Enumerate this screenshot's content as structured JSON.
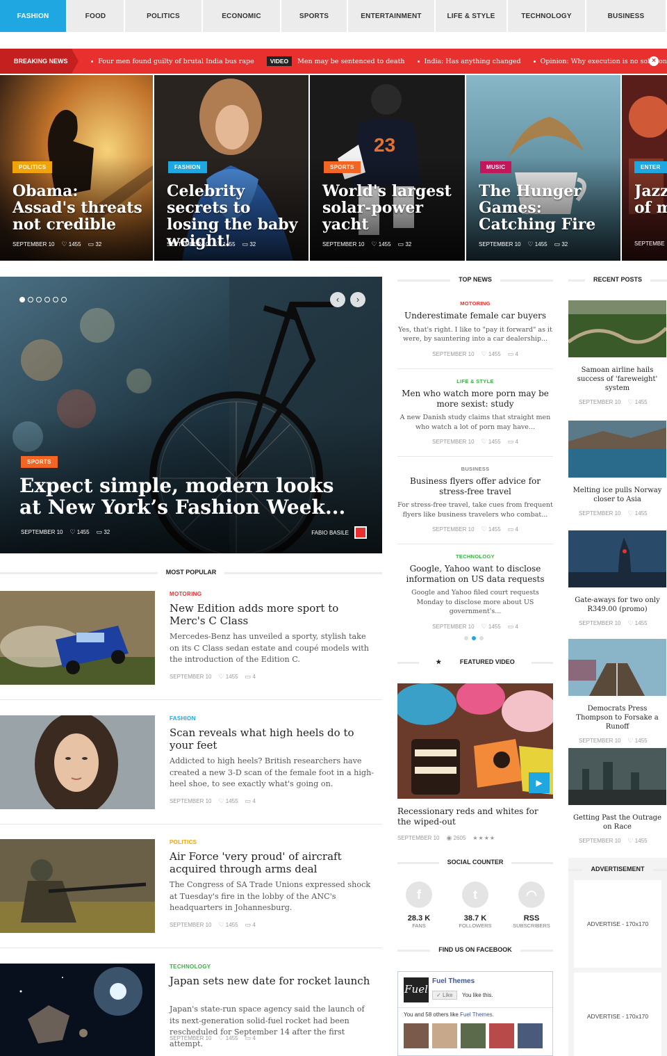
{
  "nav": [
    {
      "label": "FASHION",
      "active": true
    },
    {
      "label": "FOOD"
    },
    {
      "label": "POLITICS"
    },
    {
      "label": "ECONOMIC"
    },
    {
      "label": "SPORTS"
    },
    {
      "label": "ENTERTAINMENT"
    },
    {
      "label": "LIFE & STYLE"
    },
    {
      "label": "TECHNOLOGY"
    },
    {
      "label": "BUSINESS"
    }
  ],
  "breaking": {
    "label": "BREAKING NEWS",
    "items": [
      {
        "text": "Four men found guilty of brutal India bus rape"
      },
      {
        "tag": "VIDEO",
        "text": "Men may be sentenced to death"
      },
      {
        "text": "India: Has anything changed"
      },
      {
        "text": "Opinion: Why execution is no solution"
      }
    ],
    "close_icon": "×"
  },
  "features": [
    {
      "cat": "POLITICS",
      "color": "#f0a30a",
      "title": "Obama: Assad's threats not credible",
      "date": "SEPTEMBER 10",
      "likes": "1455",
      "comments": "32"
    },
    {
      "cat": "FASHION",
      "color": "#1ea7e1",
      "title": "Celebrity secrets to losing the baby weight!",
      "date": "SEPTEMBER 10",
      "likes": "1455",
      "comments": "32"
    },
    {
      "cat": "SPORTS",
      "color": "#f26522",
      "title": "World's largest solar-power yacht",
      "date": "SEPTEMBER 10",
      "likes": "1455",
      "comments": "32"
    },
    {
      "cat": "MUSIC",
      "color": "#c2185b",
      "title": "The Hunger Games: Catching Fire",
      "date": "SEPTEMBER 10",
      "likes": "1455",
      "comments": "32"
    },
    {
      "cat": "ENTER",
      "color": "#1ea7e1",
      "title": "Jazz of m",
      "date": "SEPTEMBE"
    }
  ],
  "hero": {
    "cat": "SPORTS",
    "color": "#f26522",
    "title": "Expect simple, modern looks at New York’s Fashion Week...",
    "date": "SEPTEMBER 10",
    "likes": "1455",
    "comments": "32",
    "author": "FABIO BASILE",
    "dots": 6,
    "active_dot": 0
  },
  "most_popular": {
    "heading": "MOST POPULAR",
    "items": [
      {
        "cat": "MOTORING",
        "color": "#e8312f",
        "title": "New Edition adds more sport to Merc's C Class",
        "excerpt": "Mercedes-Benz has unveiled a sporty, stylish take on its C Class sedan estate and coupé models with the introduction of the Edition C.",
        "date": "SEPTEMBER 10",
        "likes": "1455",
        "comments": "4"
      },
      {
        "cat": "FASHION",
        "color": "#1ea7e1",
        "title": "Scan reveals what high heels do to your feet",
        "excerpt": "Addicted to high heels? British researchers have created a new 3-D scan of the female foot in a high-heel shoe, to see exactly what's going on.",
        "date": "SEPTEMBER 10",
        "likes": "1455",
        "comments": "4"
      },
      {
        "cat": "POLITICS",
        "color": "#f0a30a",
        "title": "Air Force 'very proud' of aircraft acquired through arms deal",
        "excerpt": "The Congress of SA Trade Unions expressed shock at Tuesday's fire in the lobby of the ANC's headquarters in Johannesburg.",
        "date": "SEPTEMBER 10",
        "likes": "1455",
        "comments": "4"
      },
      {
        "cat": "TECHNOLOGY",
        "color": "#3fae49",
        "title": "Japan sets new date for rocket launch",
        "excerpt": "Japan's state-run space agency said the launch of its next-generation solid-fuel rocket had been rescheduled for September 14 after the first attempt.",
        "date": "SEPTEMBER 10",
        "likes": "1455",
        "comments": "4"
      }
    ]
  },
  "top_news": {
    "heading": "TOP NEWS",
    "items": [
      {
        "cat": "MOTORING",
        "color": "#e8312f",
        "title": "Underestimate female car buyers",
        "excerpt": "Yes, that's right. I like to \"pay it forward\" as it were, by sauntering into a car dealership...",
        "date": "SEPTEMBER 10",
        "likes": "1455",
        "comments": "4"
      },
      {
        "cat": "LIFE & STYLE",
        "color": "#3fae49",
        "title": "Men who watch more porn may be more sexist: study",
        "excerpt": "A new Danish study claims that straight men who watch a lot of porn may have...",
        "date": "SEPTEMBER 10",
        "likes": "1455",
        "comments": "4"
      },
      {
        "cat": "BUSINESS",
        "color": "#888888",
        "title": "Business flyers offer advice for stress-free travel",
        "excerpt": "For stress-free travel, take cues from frequent flyers like business travelers who combat...",
        "date": "SEPTEMBER 10",
        "likes": "1455",
        "comments": "4"
      },
      {
        "cat": "TECHNOLOGY",
        "color": "#3fae49",
        "title": "Google, Yahoo want to disclose information on US data requests",
        "excerpt": "Google and Yahoo filed court requests Monday to disclose more about US government's...",
        "date": "SEPTEMBER 10",
        "likes": "1455",
        "comments": "4"
      }
    ],
    "active_dot": 1
  },
  "recent": {
    "heading": "RECENT POSTS",
    "items": [
      {
        "title": "Samoan airline hails success of 'fareweight' system",
        "date": "SEPTEMBER 10",
        "likes": "1455"
      },
      {
        "title": "Melting ice pulls Norway closer to Asia",
        "date": "SEPTEMBER 10",
        "likes": "1455"
      },
      {
        "title": "Gate-aways for two only R349.00 (promo)",
        "date": "SEPTEMBER 10",
        "likes": "1455"
      },
      {
        "title": "Democrats Press Thompson to Forsake a Runoff",
        "date": "SEPTEMBER 10",
        "likes": "1455"
      },
      {
        "title": "Getting Past the Outrage on Race",
        "date": "SEPTEMBER 10",
        "likes": "1455"
      }
    ]
  },
  "video": {
    "heading": "FEATURED VIDEO",
    "title": "Recessionary reds and whites for the wiped-out",
    "date": "SEPTEMBER 10",
    "views": "2605",
    "stars": 4
  },
  "social": {
    "heading": "SOCIAL COUNTER",
    "items": [
      {
        "icon": "facebook-icon",
        "glyph": "f",
        "count": "28.3 K",
        "label": "FANS"
      },
      {
        "icon": "twitter-icon",
        "glyph": "t",
        "count": "38.7 K",
        "label": "FOLLOWERS"
      },
      {
        "icon": "rss-icon",
        "glyph": "◠",
        "count": "RSS",
        "label": "SUBSCRIBERS"
      }
    ]
  },
  "facebook": {
    "heading": "FIND US ON FACEBOOK",
    "logo": "Fuel",
    "page": "Fuel Themes",
    "like": "Like",
    "you_like": "You like this.",
    "others_prefix": "You and 58 others like ",
    "others_page": "Fuel Themes",
    "others_suffix": "."
  },
  "ads": {
    "heading": "ADVERTISEMENT",
    "label": "ADVERTISE - 170x170"
  }
}
